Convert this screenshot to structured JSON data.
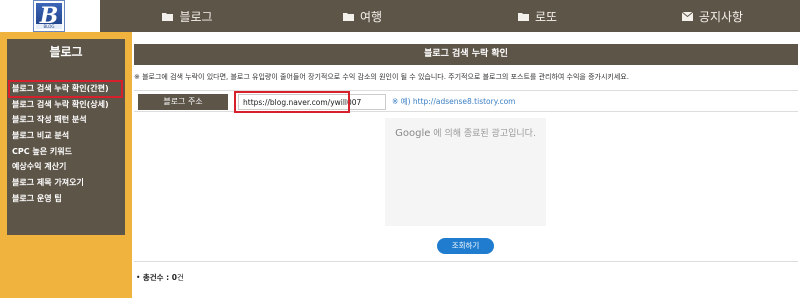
{
  "logo": {
    "letter": "B",
    "tagline": "BLOG"
  },
  "nav": [
    {
      "icon": "folder-icon",
      "label": "블로그"
    },
    {
      "icon": "folder-icon",
      "label": "여행"
    },
    {
      "icon": "folder-icon",
      "label": "로또"
    },
    {
      "icon": "mail-icon",
      "label": "공지사항"
    }
  ],
  "sidebar": {
    "title": "블로그",
    "items": [
      {
        "label": "블로그 검색 누락 확인(간편)",
        "active": true
      },
      {
        "label": "블로그 검색 누락 확인(상세)",
        "active": false
      },
      {
        "label": "블로그 작성 패턴 분석",
        "active": false
      },
      {
        "label": "블로그 비교 분석",
        "active": false
      },
      {
        "label": "CPC 높은 키워드",
        "active": false
      },
      {
        "label": "예상수익 계산기",
        "active": false
      },
      {
        "label": "블로그 제목 가져오기",
        "active": false
      },
      {
        "label": "블로그 운영 팁",
        "active": false
      }
    ]
  },
  "main": {
    "title": "블로그 검색 누락 확인",
    "notice": "※ 블로그에 검색 누락이 있다면, 블로그 유입량이 줄어들어 장기적으로 수익 감소의 원인이 될 수 있습니다. 주기적으로 블로그의 포스트를 관리하여 수익을 증가시키세요.",
    "form_label": "블로그 주소",
    "url_value": "https://blog.naver.com/ywill007",
    "example_label": "※ 예) http://adsense8.tistory.com",
    "ad_google": "Google",
    "ad_text": " 에 의해 종료된 광고입니다.",
    "submit_label": "조회하기",
    "count_label": "총건수 : ",
    "count_value": "0",
    "count_unit": "건"
  },
  "colors": {
    "header": "#5e5549",
    "sidebar_bg": "#f0b43e",
    "highlight": "#d6202c",
    "button": "#1f7ccf"
  }
}
